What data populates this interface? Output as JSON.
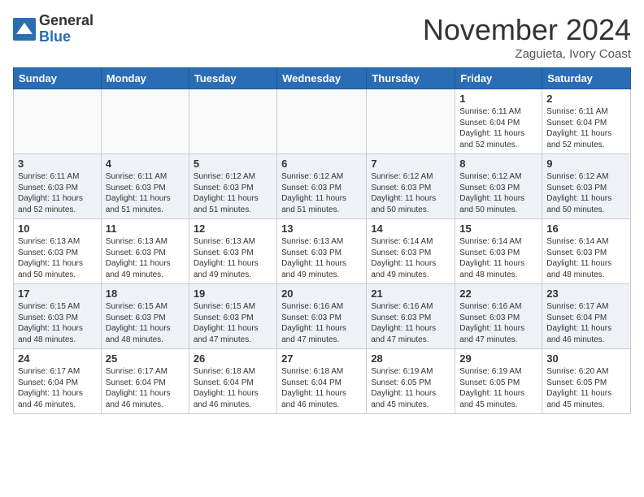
{
  "header": {
    "logo_line1": "General",
    "logo_line2": "Blue",
    "month": "November 2024",
    "location": "Zaguieta, Ivory Coast"
  },
  "days_of_week": [
    "Sunday",
    "Monday",
    "Tuesday",
    "Wednesday",
    "Thursday",
    "Friday",
    "Saturday"
  ],
  "weeks": [
    [
      {
        "day": "",
        "content": ""
      },
      {
        "day": "",
        "content": ""
      },
      {
        "day": "",
        "content": ""
      },
      {
        "day": "",
        "content": ""
      },
      {
        "day": "",
        "content": ""
      },
      {
        "day": "1",
        "content": "Sunrise: 6:11 AM\nSunset: 6:04 PM\nDaylight: 11 hours\nand 52 minutes."
      },
      {
        "day": "2",
        "content": "Sunrise: 6:11 AM\nSunset: 6:04 PM\nDaylight: 11 hours\nand 52 minutes."
      }
    ],
    [
      {
        "day": "3",
        "content": "Sunrise: 6:11 AM\nSunset: 6:03 PM\nDaylight: 11 hours\nand 52 minutes."
      },
      {
        "day": "4",
        "content": "Sunrise: 6:11 AM\nSunset: 6:03 PM\nDaylight: 11 hours\nand 51 minutes."
      },
      {
        "day": "5",
        "content": "Sunrise: 6:12 AM\nSunset: 6:03 PM\nDaylight: 11 hours\nand 51 minutes."
      },
      {
        "day": "6",
        "content": "Sunrise: 6:12 AM\nSunset: 6:03 PM\nDaylight: 11 hours\nand 51 minutes."
      },
      {
        "day": "7",
        "content": "Sunrise: 6:12 AM\nSunset: 6:03 PM\nDaylight: 11 hours\nand 50 minutes."
      },
      {
        "day": "8",
        "content": "Sunrise: 6:12 AM\nSunset: 6:03 PM\nDaylight: 11 hours\nand 50 minutes."
      },
      {
        "day": "9",
        "content": "Sunrise: 6:12 AM\nSunset: 6:03 PM\nDaylight: 11 hours\nand 50 minutes."
      }
    ],
    [
      {
        "day": "10",
        "content": "Sunrise: 6:13 AM\nSunset: 6:03 PM\nDaylight: 11 hours\nand 50 minutes."
      },
      {
        "day": "11",
        "content": "Sunrise: 6:13 AM\nSunset: 6:03 PM\nDaylight: 11 hours\nand 49 minutes."
      },
      {
        "day": "12",
        "content": "Sunrise: 6:13 AM\nSunset: 6:03 PM\nDaylight: 11 hours\nand 49 minutes."
      },
      {
        "day": "13",
        "content": "Sunrise: 6:13 AM\nSunset: 6:03 PM\nDaylight: 11 hours\nand 49 minutes."
      },
      {
        "day": "14",
        "content": "Sunrise: 6:14 AM\nSunset: 6:03 PM\nDaylight: 11 hours\nand 49 minutes."
      },
      {
        "day": "15",
        "content": "Sunrise: 6:14 AM\nSunset: 6:03 PM\nDaylight: 11 hours\nand 48 minutes."
      },
      {
        "day": "16",
        "content": "Sunrise: 6:14 AM\nSunset: 6:03 PM\nDaylight: 11 hours\nand 48 minutes."
      }
    ],
    [
      {
        "day": "17",
        "content": "Sunrise: 6:15 AM\nSunset: 6:03 PM\nDaylight: 11 hours\nand 48 minutes."
      },
      {
        "day": "18",
        "content": "Sunrise: 6:15 AM\nSunset: 6:03 PM\nDaylight: 11 hours\nand 48 minutes."
      },
      {
        "day": "19",
        "content": "Sunrise: 6:15 AM\nSunset: 6:03 PM\nDaylight: 11 hours\nand 47 minutes."
      },
      {
        "day": "20",
        "content": "Sunrise: 6:16 AM\nSunset: 6:03 PM\nDaylight: 11 hours\nand 47 minutes."
      },
      {
        "day": "21",
        "content": "Sunrise: 6:16 AM\nSunset: 6:03 PM\nDaylight: 11 hours\nand 47 minutes."
      },
      {
        "day": "22",
        "content": "Sunrise: 6:16 AM\nSunset: 6:03 PM\nDaylight: 11 hours\nand 47 minutes."
      },
      {
        "day": "23",
        "content": "Sunrise: 6:17 AM\nSunset: 6:04 PM\nDaylight: 11 hours\nand 46 minutes."
      }
    ],
    [
      {
        "day": "24",
        "content": "Sunrise: 6:17 AM\nSunset: 6:04 PM\nDaylight: 11 hours\nand 46 minutes."
      },
      {
        "day": "25",
        "content": "Sunrise: 6:17 AM\nSunset: 6:04 PM\nDaylight: 11 hours\nand 46 minutes."
      },
      {
        "day": "26",
        "content": "Sunrise: 6:18 AM\nSunset: 6:04 PM\nDaylight: 11 hours\nand 46 minutes."
      },
      {
        "day": "27",
        "content": "Sunrise: 6:18 AM\nSunset: 6:04 PM\nDaylight: 11 hours\nand 46 minutes."
      },
      {
        "day": "28",
        "content": "Sunrise: 6:19 AM\nSunset: 6:05 PM\nDaylight: 11 hours\nand 45 minutes."
      },
      {
        "day": "29",
        "content": "Sunrise: 6:19 AM\nSunset: 6:05 PM\nDaylight: 11 hours\nand 45 minutes."
      },
      {
        "day": "30",
        "content": "Sunrise: 6:20 AM\nSunset: 6:05 PM\nDaylight: 11 hours\nand 45 minutes."
      }
    ]
  ]
}
